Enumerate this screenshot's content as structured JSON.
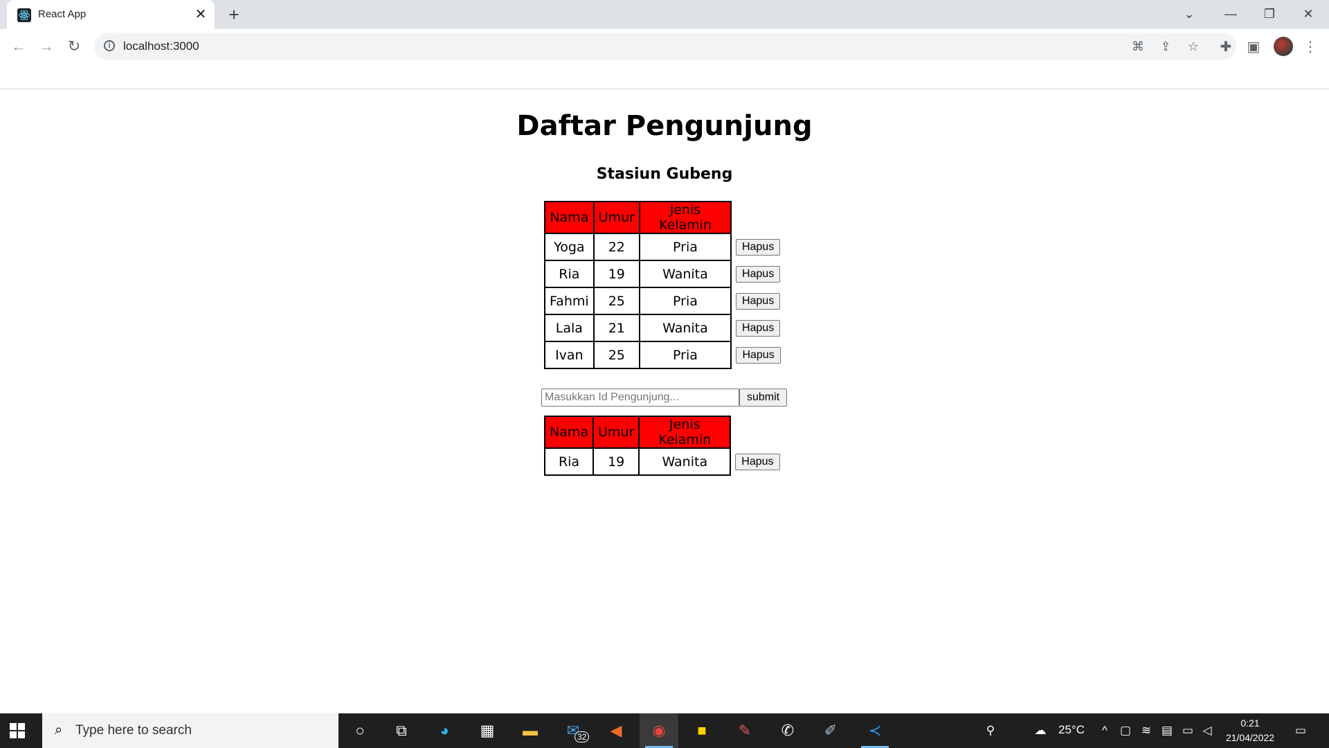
{
  "browser": {
    "tab_title": "React App",
    "new_tab_label": "+",
    "url": "localhost:3000"
  },
  "page": {
    "title": "Daftar Pengunjung",
    "subtitle": "Stasiun Gubeng",
    "columns": [
      "Nama",
      "Umur",
      "Jenis Kelamin"
    ],
    "rows": [
      {
        "nama": "Yoga",
        "umur": "22",
        "jenis_kelamin": "Pria",
        "action": "Hapus"
      },
      {
        "nama": "Ria",
        "umur": "19",
        "jenis_kelamin": "Wanita",
        "action": "Hapus"
      },
      {
        "nama": "Fahmi",
        "umur": "25",
        "jenis_kelamin": "Pria",
        "action": "Hapus"
      },
      {
        "nama": "Lala",
        "umur": "21",
        "jenis_kelamin": "Wanita",
        "action": "Hapus"
      },
      {
        "nama": "Ivan",
        "umur": "25",
        "jenis_kelamin": "Pria",
        "action": "Hapus"
      }
    ],
    "search": {
      "placeholder": "Masukkan Id Pengunjung...",
      "value": "",
      "submit_label": "submit"
    },
    "result_rows": [
      {
        "nama": "Ria",
        "umur": "19",
        "jenis_kelamin": "Wanita",
        "action": "Hapus"
      }
    ],
    "header_color": "#ff0000"
  },
  "taskbar": {
    "search_placeholder": "Type here to search",
    "mail_badge": "32",
    "weather": "25°C",
    "time": "0:21",
    "date": "21/04/2022",
    "apps": [
      "cortana-icon",
      "task-view-icon",
      "edge-icon",
      "store-icon",
      "file-explorer-icon",
      "mail-icon",
      "media-icon",
      "chrome-icon",
      "sticky-notes-icon",
      "paint-icon",
      "whatsapp-icon",
      "paint3d-icon",
      "vscode-icon"
    ]
  }
}
